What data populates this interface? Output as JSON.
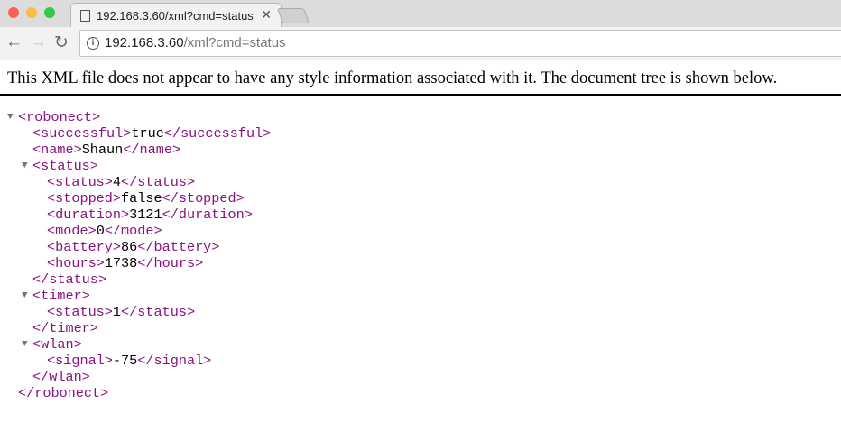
{
  "browser": {
    "tab_title": "192.168.3.60/xml?cmd=status",
    "url_host": "192.168.3.60",
    "url_path": "/xml?cmd=status",
    "close": "✕",
    "back": "←",
    "forward": "→",
    "reload": "↻",
    "info": "i"
  },
  "notice": "This XML file does not appear to have any style information associated with it. The document tree is shown below.",
  "tree": [
    {
      "depth": 0,
      "toggle": true,
      "open": "<robonect>"
    },
    {
      "depth": 1,
      "open": "<successful>",
      "value": "true",
      "close": "</successful>"
    },
    {
      "depth": 1,
      "open": "<name>",
      "value": "Shaun",
      "close": "</name>"
    },
    {
      "depth": 1,
      "toggle": true,
      "open": "<status>"
    },
    {
      "depth": 2,
      "open": "<status>",
      "value": "4",
      "close": "</status>"
    },
    {
      "depth": 2,
      "open": "<stopped>",
      "value": "false",
      "close": "</stopped>"
    },
    {
      "depth": 2,
      "open": "<duration>",
      "value": "3121",
      "close": "</duration>"
    },
    {
      "depth": 2,
      "open": "<mode>",
      "value": "0",
      "close": "</mode>"
    },
    {
      "depth": 2,
      "open": "<battery>",
      "value": "86",
      "close": "</battery>"
    },
    {
      "depth": 2,
      "open": "<hours>",
      "value": "1738",
      "close": "</hours>"
    },
    {
      "depth": 1,
      "close": "</status>"
    },
    {
      "depth": 1,
      "toggle": true,
      "open": "<timer>"
    },
    {
      "depth": 2,
      "open": "<status>",
      "value": "1",
      "close": "</status>"
    },
    {
      "depth": 1,
      "close": "</timer>"
    },
    {
      "depth": 1,
      "toggle": true,
      "open": "<wlan>"
    },
    {
      "depth": 2,
      "open": "<signal>",
      "value": "-75",
      "close": "</signal>"
    },
    {
      "depth": 1,
      "close": "</wlan>"
    },
    {
      "depth": 0,
      "close": "</robonect>"
    }
  ]
}
